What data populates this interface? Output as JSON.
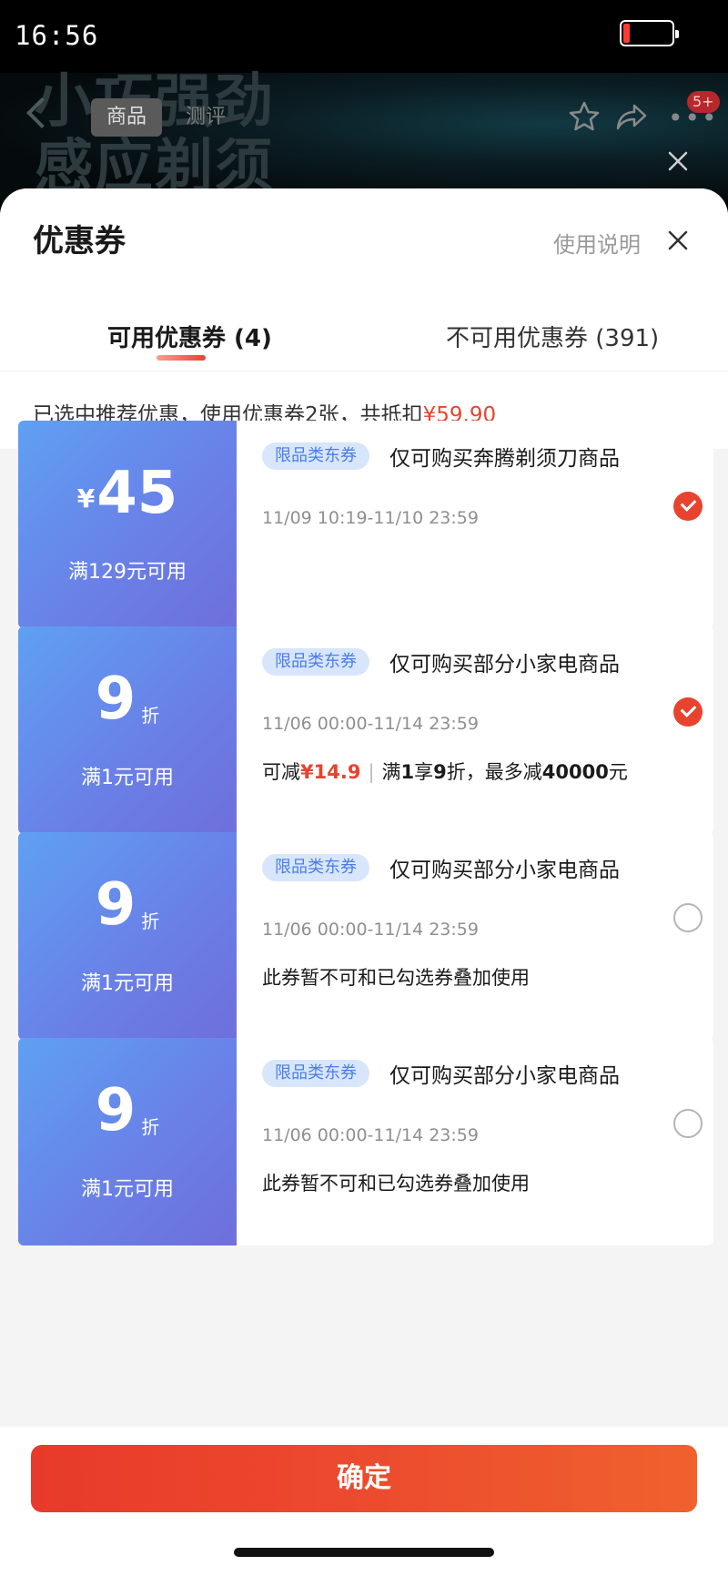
{
  "status_bar": {
    "time": "16:56"
  },
  "product_header": {
    "banner_text": "小巧强劲\n感应剃须",
    "tabs": [
      "商品",
      "测评"
    ],
    "active_tab": "商品",
    "message_badge": "5+",
    "icons": [
      "back-icon",
      "star-icon",
      "share-icon",
      "more-icon",
      "close-icon"
    ]
  },
  "sheet": {
    "title": "优惠券",
    "help_label": "使用说明",
    "tabs": [
      {
        "label": "可用优惠券 (4)",
        "active": true
      },
      {
        "label": "不可用优惠券 (391)",
        "active": false
      }
    ],
    "summary": {
      "text": "已选中推荐优惠，使用优惠券2张，共抵扣",
      "amount": "¥59.90"
    }
  },
  "coupons": [
    {
      "currency": "¥",
      "value": "45",
      "unit": "",
      "threshold": "满129元可用",
      "tag": "限品类东券",
      "restriction": "仅可购买奔腾剃须刀商品",
      "validity": "11/09 10:19-11/10 23:59",
      "selected": true
    },
    {
      "currency": "",
      "value": "9",
      "unit": "折",
      "threshold": "满1元可用",
      "tag": "限品类东券",
      "restriction": "仅可购买部分小家电商品",
      "validity": "11/06 00:00-11/14 23:59",
      "selected": true,
      "savings": {
        "prefix": "可减",
        "amount": "¥14.9",
        "rule_1": "满",
        "rule_2": "1",
        "rule_3": "享",
        "rule_4": "9",
        "rule_5": "折，最多减",
        "rule_6": "40000",
        "rule_7": "元"
      }
    },
    {
      "currency": "",
      "value": "9",
      "unit": "折",
      "threshold": "满1元可用",
      "tag": "限品类东券",
      "restriction": "仅可购买部分小家电商品",
      "validity": "11/06 00:00-11/14 23:59",
      "selected": false,
      "note": "此券暂不可和已勾选券叠加使用"
    },
    {
      "currency": "",
      "value": "9",
      "unit": "折",
      "threshold": "满1元可用",
      "tag": "限品类东券",
      "restriction": "仅可购买部分小家电商品",
      "validity": "11/06 00:00-11/14 23:59",
      "selected": false,
      "note": "此券暂不可和已勾选券叠加使用"
    }
  ],
  "footer": {
    "confirm_label": "确定"
  },
  "colors": {
    "accent": "#e8432e",
    "coupon_blue": "#6a7fe6",
    "tag_bg": "#d8e6fb",
    "tag_text": "#4b7de8"
  }
}
